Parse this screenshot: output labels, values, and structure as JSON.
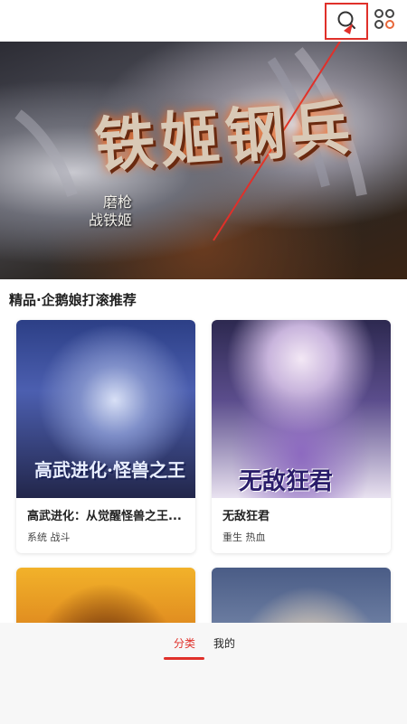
{
  "topbar": {
    "search_icon": "search-icon",
    "apps_icon": "grid-icon",
    "highlight_color": "#e0302a"
  },
  "banner": {
    "title": "铁姬钢兵",
    "subtitle_line1": "磨枪",
    "subtitle_line2": "战铁姬"
  },
  "section": {
    "title": "精品·企鹅娘打滚推荐"
  },
  "comics": [
    {
      "name": "高武进化：从觉醒怪兽之王...",
      "tags": "系统 战斗",
      "cover_title": "高武进化·怪兽之王"
    },
    {
      "name": "无敌狂君",
      "tags": "重生 热血",
      "cover_title": "无敌狂君"
    },
    {
      "name": "",
      "tags": "",
      "cover_title": ""
    },
    {
      "name": "",
      "tags": "",
      "cover_title": ""
    }
  ],
  "bottom_nav": {
    "tabs": [
      {
        "label": "分类",
        "active": true
      },
      {
        "label": "我的",
        "active": false
      }
    ],
    "accent": "#e0302a"
  }
}
